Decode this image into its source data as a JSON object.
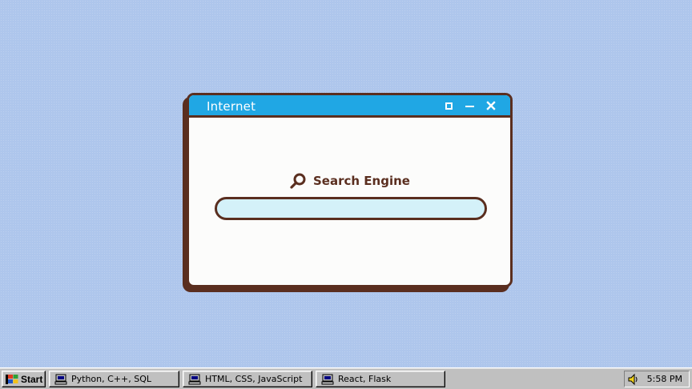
{
  "window": {
    "title": "Internet",
    "controls": {
      "maximize": "maximize-icon",
      "minimize": "minimize-icon",
      "close": "close-icon"
    }
  },
  "search": {
    "heading": "Search Engine",
    "icon": "search-icon",
    "input_value": "",
    "placeholder": ""
  },
  "taskbar": {
    "start_label": "Start",
    "tasks": [
      {
        "label": "Python, C++, SQL",
        "icon": "computer-icon"
      },
      {
        "label": "HTML, CSS, JavaScript",
        "icon": "computer-icon"
      },
      {
        "label": "React, Flask",
        "icon": "computer-icon"
      }
    ],
    "tray": {
      "icon": "speaker-icon",
      "clock": "5:58 PM"
    }
  },
  "colors": {
    "desktop": "#aec6ec",
    "titlebar": "#20a7e4",
    "border": "#5a2e1f",
    "window_bg": "#fcfcfb",
    "input_bg": "#d4f1f9",
    "taskbar": "#c0c0c0"
  }
}
